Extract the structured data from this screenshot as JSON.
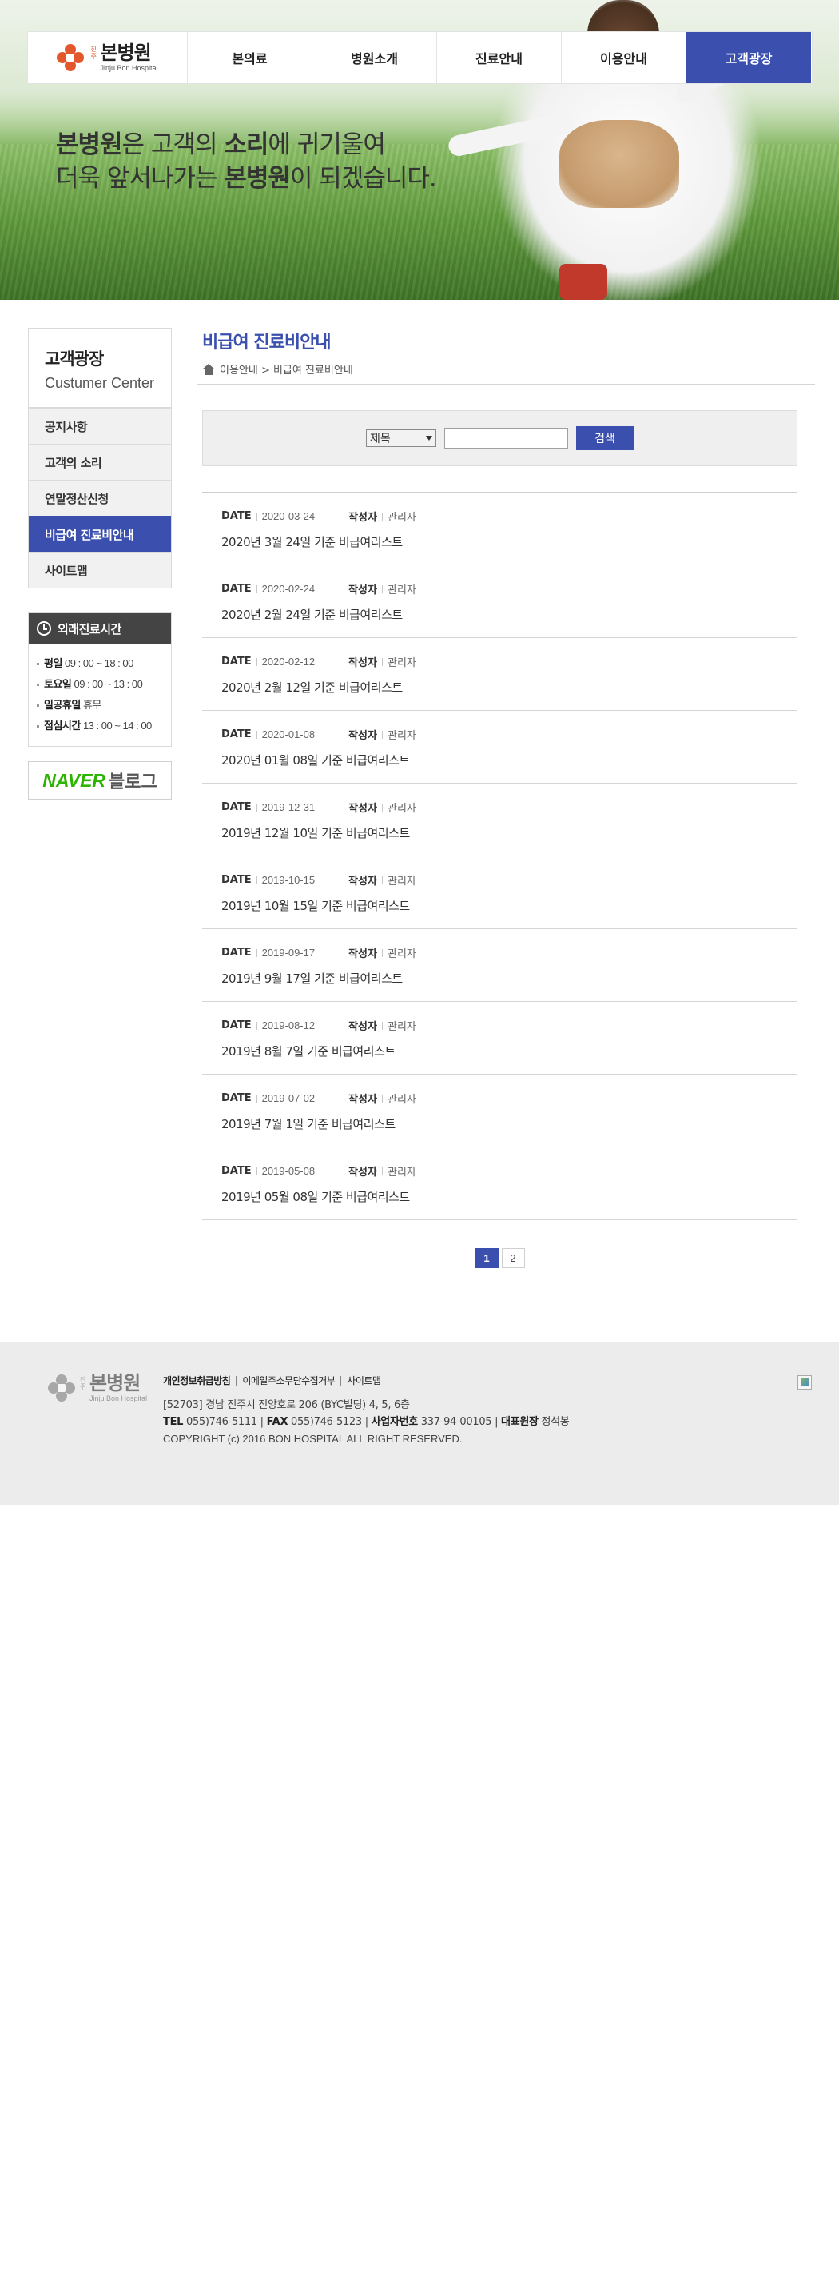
{
  "hero": {
    "line1_a": "본병원",
    "line1_b": "은 고객의 ",
    "line1_c": "소리",
    "line1_d": "에 귀기울여",
    "line2_a": "더욱 앞서나가는 ",
    "line2_b": "본병원",
    "line2_c": "이 되겠습니다."
  },
  "header": {
    "logo_small": "진주",
    "logo_ko": "본병원",
    "logo_en": "Jinju Bon Hospital",
    "nav": [
      {
        "label": "본의료"
      },
      {
        "label": "병원소개"
      },
      {
        "label": "진료안내"
      },
      {
        "label": "이용안내"
      },
      {
        "label": "고객광장"
      }
    ]
  },
  "sidebar": {
    "title": "고객광장",
    "subtitle": "Custumer Center",
    "items": [
      {
        "label": "공지사항"
      },
      {
        "label": "고객의 소리"
      },
      {
        "label": "연말정산신청"
      },
      {
        "label": "비급여 진료비안내"
      },
      {
        "label": "사이트맵"
      }
    ],
    "hours": {
      "title": "외래진료시간",
      "rows": [
        {
          "label": "평일",
          "value": " 09 : 00 ~ 18 : 00"
        },
        {
          "label": "토요일",
          "value": " 09 : 00 ~ 13 : 00"
        },
        {
          "label": "일공휴일",
          "value": " 휴무"
        },
        {
          "label": "점심시간",
          "value": " 13 : 00 ~ 14 : 00"
        }
      ]
    },
    "blog": {
      "naver": "NAVER",
      "text": "블로그"
    }
  },
  "main": {
    "title": "비급여 진료비안내",
    "breadcrumb": "이용안내 > 비급여 진료비안내",
    "search": {
      "select_value": "제목",
      "input_value": "",
      "button_label": "검색"
    },
    "date_label": "DATE",
    "writer_label": "작성자",
    "posts": [
      {
        "date": "2020-03-24",
        "writer": "관리자",
        "title": "2020년 3월 24일 기준 비급여리스트"
      },
      {
        "date": "2020-02-24",
        "writer": "관리자",
        "title": "2020년 2월 24일 기준 비급여리스트"
      },
      {
        "date": "2020-02-12",
        "writer": "관리자",
        "title": "2020년 2월 12일 기준 비급여리스트"
      },
      {
        "date": "2020-01-08",
        "writer": "관리자",
        "title": "2020년 01월 08일 기준 비급여리스트"
      },
      {
        "date": "2019-12-31",
        "writer": "관리자",
        "title": "2019년 12월 10일 기준 비급여리스트"
      },
      {
        "date": "2019-10-15",
        "writer": "관리자",
        "title": "2019년 10월 15일 기준 비급여리스트"
      },
      {
        "date": "2019-09-17",
        "writer": "관리자",
        "title": "2019년 9월 17일 기준 비급여리스트"
      },
      {
        "date": "2019-08-12",
        "writer": "관리자",
        "title": "2019년 8월 7일 기준 비급여리스트"
      },
      {
        "date": "2019-07-02",
        "writer": "관리자",
        "title": "2019년 7월 1일 기준 비급여리스트"
      },
      {
        "date": "2019-05-08",
        "writer": "관리자",
        "title": "2019년 05월 08일 기준 비급여리스트"
      }
    ],
    "pagination": {
      "pages": [
        "1",
        "2"
      ],
      "current": "1"
    }
  },
  "footer": {
    "links": [
      "개인정보취급방침",
      "이메일주소무단수집거부",
      "사이트맵"
    ],
    "address": "[52703] 경남 진주시 진양호로 206 (BYC빌딩) 4, 5, 6층",
    "tel_label": "TEL",
    "tel": " 055)746-5111 | ",
    "fax_label": "FAX",
    "fax": " 055)746-5123 | ",
    "biz_label": "사업자번호",
    "biz": " 337-94-00105 | ",
    "ceo_label": "대표원장",
    "ceo": " 정석봉",
    "copyright": "COPYRIGHT (c) 2016 BON HOSPITAL ALL RIGHT RESERVED."
  },
  "colors": {
    "accent": "#3a4fae",
    "naver_green": "#2db400",
    "logo_orange": "#e2572b",
    "hours_header": "#444444",
    "footer_bg": "#ececec"
  }
}
